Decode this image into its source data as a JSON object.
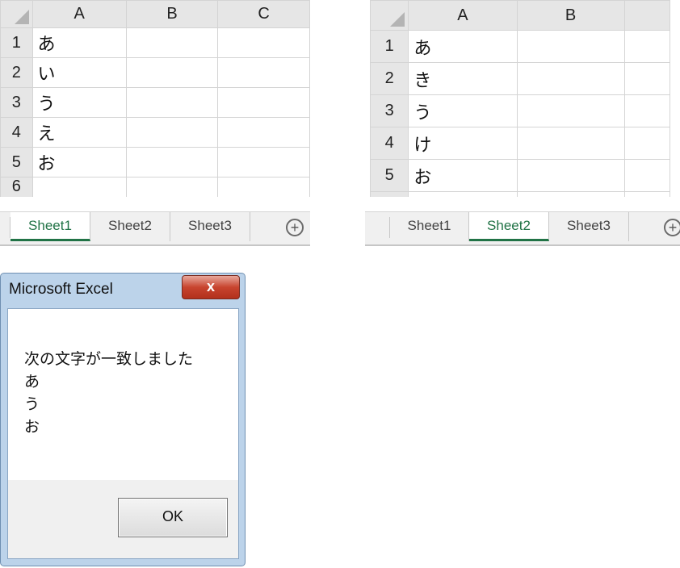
{
  "left_sheet": {
    "columns": [
      "A",
      "B",
      "C"
    ],
    "rows": [
      {
        "num": "1",
        "a": "あ"
      },
      {
        "num": "2",
        "a": "い"
      },
      {
        "num": "3",
        "a": "う"
      },
      {
        "num": "4",
        "a": "え"
      },
      {
        "num": "5",
        "a": "お"
      },
      {
        "num": "6",
        "a": ""
      }
    ],
    "tabs": [
      "Sheet1",
      "Sheet2",
      "Sheet3"
    ],
    "active_tab": "Sheet1",
    "add_sheet_symbol": "+"
  },
  "right_sheet": {
    "columns": [
      "A",
      "B"
    ],
    "rows": [
      {
        "num": "1",
        "a": "あ"
      },
      {
        "num": "2",
        "a": "き"
      },
      {
        "num": "3",
        "a": "う"
      },
      {
        "num": "4",
        "a": "け"
      },
      {
        "num": "5",
        "a": "お"
      }
    ],
    "tabs": [
      "Sheet1",
      "Sheet2",
      "Sheet3"
    ],
    "active_tab": "Sheet2",
    "add_sheet_symbol": "+"
  },
  "dialog": {
    "title": "Microsoft Excel",
    "close_symbol": "x",
    "message_lines": [
      "次の文字が一致しました",
      "あ",
      "う",
      "お"
    ],
    "ok_label": "OK"
  },
  "colors": {
    "active_tab": "#217346",
    "header_bg": "#e6e6e6",
    "gridline": "#d4d4d4",
    "dialog_frame": "#bcd3ea",
    "close_button": "#c8442f"
  }
}
